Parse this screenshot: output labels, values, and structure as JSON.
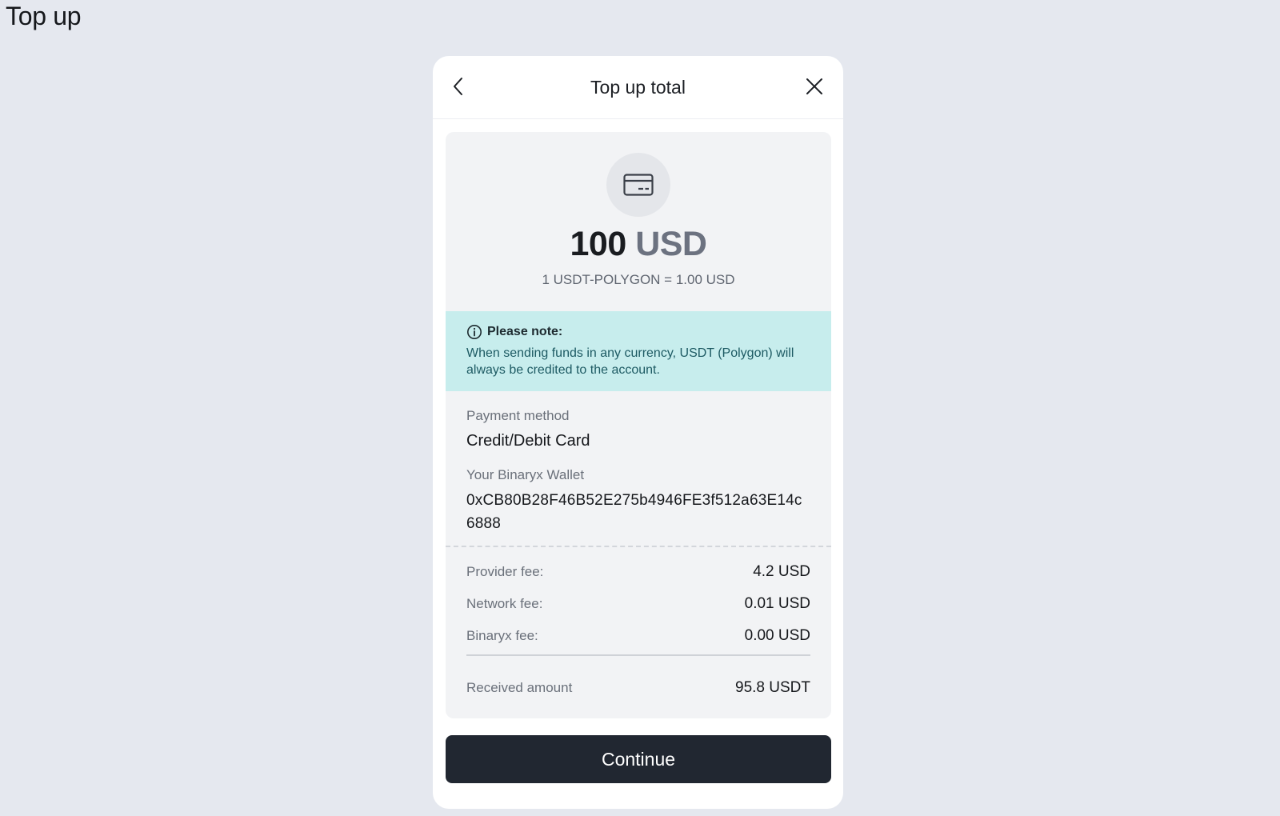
{
  "page": {
    "title": "Top up"
  },
  "modal": {
    "title": "Top up total",
    "back_icon": "chevron-left-icon",
    "close_icon": "close-icon"
  },
  "summary": {
    "icon": "credit-card-icon",
    "amount": "100",
    "currency": "USD",
    "rate": "1 USDT-POLYGON = 1.00 USD"
  },
  "notice": {
    "icon": "info-icon",
    "title": "Please note:",
    "text": "When sending funds in any currency, USDT (Polygon) will always be credited to the account.",
    "background": "#c7eded"
  },
  "payment": {
    "method_label": "Payment method",
    "method_value": "Credit/Debit Card",
    "wallet_label": "Your Binaryx Wallet",
    "wallet_value": "0xCB80B28F46B52E275b4946FE3f512a63E14c6888"
  },
  "fees": [
    {
      "label": "Provider fee:",
      "value": "4.2 USD"
    },
    {
      "label": "Network fee:",
      "value": "0.01 USD"
    },
    {
      "label": "Binaryx fee:",
      "value": "0.00 USD"
    }
  ],
  "received": {
    "label": "Received amount",
    "value": "95.8 USDT"
  },
  "actions": {
    "continue_label": "Continue",
    "continue_color": "#212731"
  }
}
